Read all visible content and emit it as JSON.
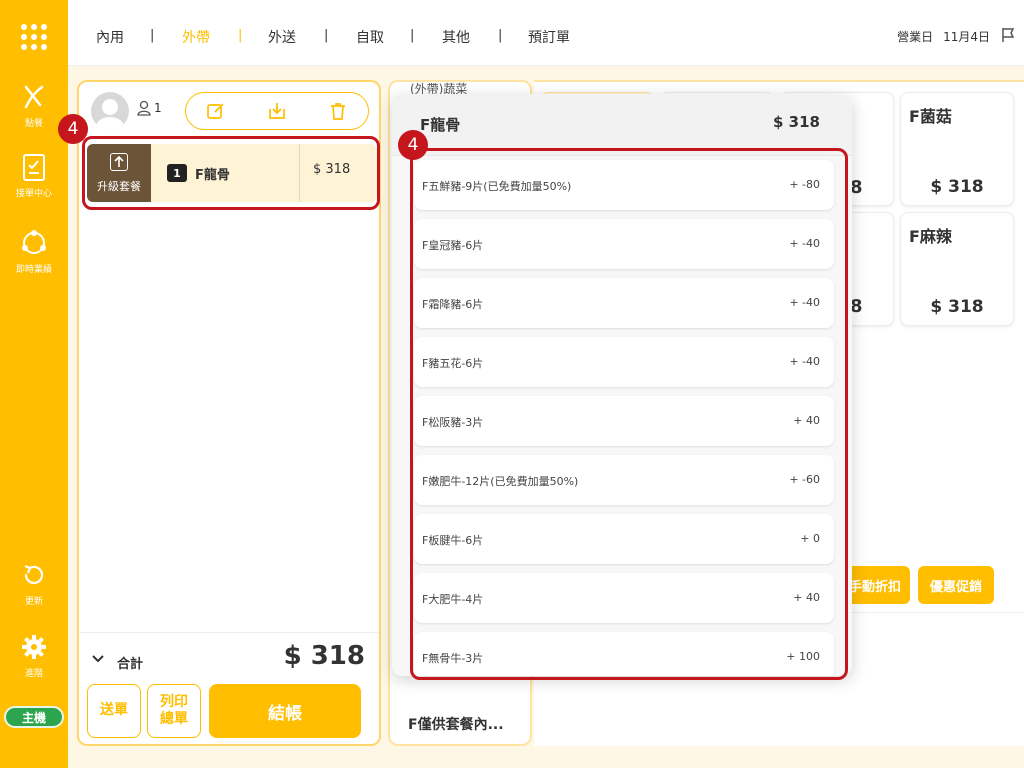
{
  "sidebar": {
    "items": [
      {
        "label": "點餐",
        "icon": "fork-knife-icon"
      },
      {
        "label": "接單中心",
        "icon": "clipboard-icon"
      },
      {
        "label": "即時業績",
        "icon": "chart-cycle-icon"
      },
      {
        "label": "更新",
        "icon": "refresh-icon"
      },
      {
        "label": "進階",
        "icon": "gear-icon"
      }
    ],
    "host_badge": "主機"
  },
  "header": {
    "tabs": [
      "內用",
      "外帶",
      "外送",
      "自取",
      "其他",
      "預訂單"
    ],
    "active_tab": "外帶",
    "separator": "|",
    "business_day_label": "營業日",
    "business_day_value": "11月4日"
  },
  "order": {
    "guest_count": "1",
    "item": {
      "upgrade_label": "升級套餐",
      "qty": "1",
      "name": "F龍骨",
      "price": "$ 318"
    },
    "total_label": "合計",
    "total_amount": "$ 318",
    "send_label": "送單",
    "print_label_line1": "列印",
    "print_label_line2": "總單",
    "checkout_label": "結帳"
  },
  "categories": {
    "top_partial": "(外帶)蔬菜",
    "bottom": "F僅供套餐內..."
  },
  "products": [
    {
      "name": "F菌菇",
      "price": "$ 318"
    },
    {
      "name": "F麻辣",
      "price": "$ 318"
    }
  ],
  "partial_digits": [
    "8",
    "8"
  ],
  "promo_buttons": [
    "手動折扣",
    "優惠促銷"
  ],
  "popup": {
    "title": "F龍骨",
    "price": "$ 318",
    "options": [
      {
        "name": "F五鮮豬-9片(已免費加量50%)",
        "price": "+ -80"
      },
      {
        "name": "F皇冠豬-6片",
        "price": "+ -40"
      },
      {
        "name": "F霜降豬-6片",
        "price": "+ -40"
      },
      {
        "name": "F豬五花-6片",
        "price": "+ -40"
      },
      {
        "name": "F松阪豬-3片",
        "price": "+ 40"
      },
      {
        "name": "F嫩肥牛-12片(已免費加量50%)",
        "price": "+ -60"
      },
      {
        "name": "F板腱牛-6片",
        "price": "+ 0"
      },
      {
        "name": "F大肥牛-4片",
        "price": "+ 40"
      },
      {
        "name": "F無骨牛-3片",
        "price": "+ 100"
      }
    ]
  },
  "annotations": {
    "step_left": "4",
    "step_right": "4",
    "highlight_color": "#C4161C"
  },
  "colors": {
    "brand": "#FFBE00",
    "host_green": "#2DA44E",
    "upgrade_brown": "#6B5437"
  }
}
